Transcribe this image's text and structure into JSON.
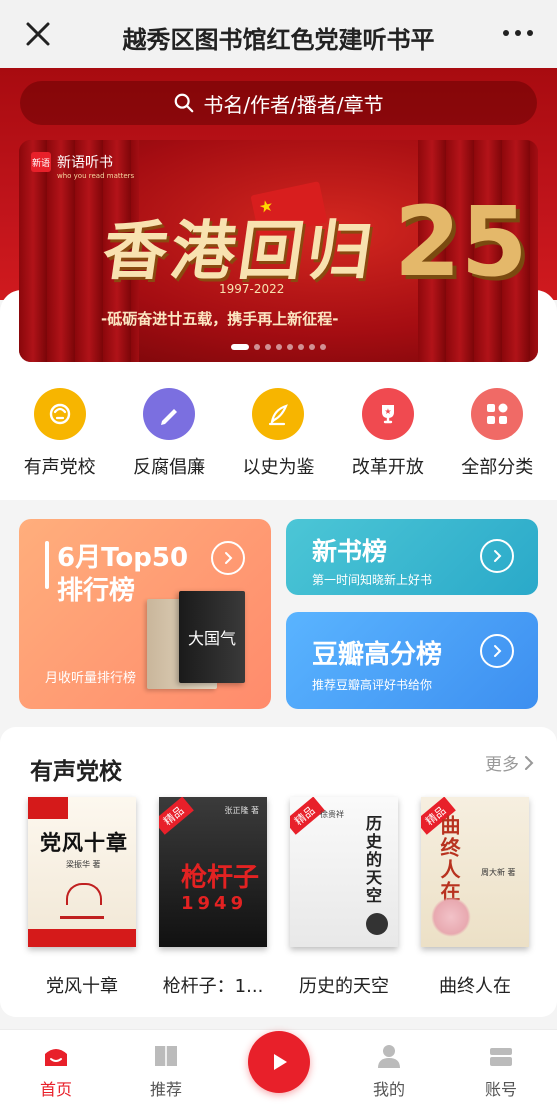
{
  "topbar": {
    "title": "越秀区图书馆红色党建听书平",
    "close_icon": "close-icon",
    "more_icon": "more-dots-icon"
  },
  "search": {
    "placeholder": "书名/作者/播者/章节",
    "icon": "search-icon"
  },
  "banner": {
    "brand_name": "新语听书",
    "brand_logo_text": "新语",
    "brand_slogan": "who you read matters",
    "headline": "香港回归",
    "years": "1997-2022",
    "number": "25",
    "subtitle": "-砥砺奋进廿五载，携手再上新征程-",
    "slide_count": 8,
    "active_slide": 1
  },
  "categories": [
    {
      "label": "有声党校",
      "icon": "party-school-icon",
      "color": "#f7b500"
    },
    {
      "label": "反腐倡廉",
      "icon": "pen-icon",
      "color": "#7b6fe0"
    },
    {
      "label": "以史为鉴",
      "icon": "quill-icon",
      "color": "#f7b500"
    },
    {
      "label": "改革开放",
      "icon": "trophy-icon",
      "color": "#f04a50"
    },
    {
      "label": "全部分类",
      "icon": "grid-icon",
      "color": "#f06a66"
    }
  ],
  "ranks": {
    "monthly": {
      "title_line1": "6月Top50",
      "title_line2": "排行榜",
      "desc": "月收听量排行榜",
      "book_text": "大国气"
    },
    "new": {
      "title": "新书榜",
      "desc": "第一时间知晓新上好书"
    },
    "douban": {
      "title": "豆瓣高分榜",
      "desc": "推荐豆瓣高评好书给你"
    }
  },
  "section": {
    "title": "有声党校",
    "more_label": "更多",
    "books": [
      {
        "name": "党风十章",
        "cover_title": "党风十章",
        "cover_author": "梁振华 著",
        "tag": ""
      },
      {
        "name": "枪杆子：1...",
        "cover_title": "枪杆子",
        "cover_year": "1949",
        "cover_author": "张正隆 著",
        "tag": "精品"
      },
      {
        "name": "历史的天空",
        "cover_title": "历史的天空",
        "cover_author": "徐贵祥",
        "tag": "精品"
      },
      {
        "name": "曲终人在",
        "cover_title": "曲终人在",
        "cover_author": "周大新 著",
        "tag": "精品"
      }
    ]
  },
  "bottomnav": {
    "items": [
      {
        "label": "首页",
        "icon": "home-icon",
        "active": true
      },
      {
        "label": "推荐",
        "icon": "book-icon",
        "active": false
      },
      {
        "label": "我的",
        "icon": "user-icon",
        "active": false
      },
      {
        "label": "账号",
        "icon": "account-icon",
        "active": false
      }
    ],
    "play_icon": "play-icon"
  },
  "colors": {
    "brand_red": "#e8202a",
    "header_red": "#c0141b"
  }
}
